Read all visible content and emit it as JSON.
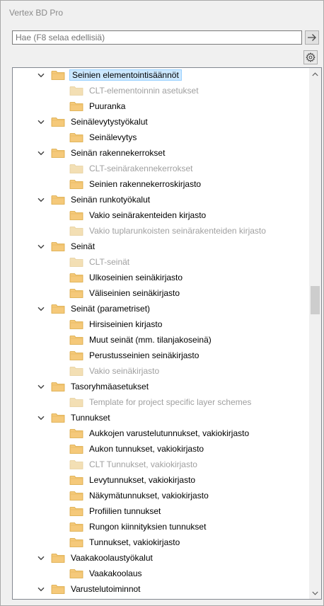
{
  "window": {
    "title": "Vertex BD Pro"
  },
  "search": {
    "placeholder": "Hae (F8 selaa edellisiä)",
    "value": ""
  },
  "icons": {
    "go": "arrow-right-icon",
    "settings": "gear-icon",
    "folder": "folder-icon",
    "expand": "chevron-down-icon"
  },
  "colors": {
    "folder": "#f5c97a",
    "folder_disabled": "#f3dfb4",
    "selection": "#cce8ff",
    "disabled_text": "#a0a0a0"
  },
  "tree": {
    "items": [
      {
        "label": "Seinien elementointisäännöt",
        "level": 0,
        "expanded": true,
        "selected": true,
        "disabled": false
      },
      {
        "label": "CLT-elementoinnin asetukset",
        "level": 1,
        "disabled": true
      },
      {
        "label": "Puuranka",
        "level": 1,
        "disabled": false
      },
      {
        "label": "Seinälevytystyökalut",
        "level": 0,
        "expanded": true,
        "disabled": false
      },
      {
        "label": "Seinälevytys",
        "level": 1,
        "disabled": false
      },
      {
        "label": "Seinän rakennekerrokset",
        "level": 0,
        "expanded": true,
        "disabled": false
      },
      {
        "label": "CLT-seinärakennekerrokset",
        "level": 1,
        "disabled": true
      },
      {
        "label": "Seinien rakennekerroskirjasto",
        "level": 1,
        "disabled": false
      },
      {
        "label": "Seinän runkotyökalut",
        "level": 0,
        "expanded": true,
        "disabled": false
      },
      {
        "label": "Vakio seinärakenteiden kirjasto",
        "level": 1,
        "disabled": false
      },
      {
        "label": "Vakio tuplarunkoisten seinärakenteiden kirjasto",
        "level": 1,
        "disabled": true
      },
      {
        "label": "Seinät",
        "level": 0,
        "expanded": true,
        "disabled": false
      },
      {
        "label": "CLT-seinät",
        "level": 1,
        "disabled": true
      },
      {
        "label": "Ulkoseinien seinäkirjasto",
        "level": 1,
        "disabled": false
      },
      {
        "label": "Väliseinien seinäkirjasto",
        "level": 1,
        "disabled": false
      },
      {
        "label": "Seinät (parametriset)",
        "level": 0,
        "expanded": true,
        "disabled": false
      },
      {
        "label": "Hirsiseinien kirjasto",
        "level": 1,
        "disabled": false
      },
      {
        "label": "Muut seinät (mm. tilanjakoseinä)",
        "level": 1,
        "disabled": false
      },
      {
        "label": "Perustusseinien seinäkirjasto",
        "level": 1,
        "disabled": false
      },
      {
        "label": "Vakio seinäkirjasto",
        "level": 1,
        "disabled": true
      },
      {
        "label": "Tasoryhmäasetukset",
        "level": 0,
        "expanded": true,
        "disabled": false
      },
      {
        "label": "Template for project specific layer schemes",
        "level": 1,
        "disabled": true
      },
      {
        "label": "Tunnukset",
        "level": 0,
        "expanded": true,
        "disabled": false
      },
      {
        "label": "Aukkojen varustelutunnukset, vakiokirjasto",
        "level": 1,
        "disabled": false
      },
      {
        "label": "Aukon tunnukset, vakiokirjasto",
        "level": 1,
        "disabled": false
      },
      {
        "label": "CLT Tunnukset, vakiokirjasto",
        "level": 1,
        "disabled": true
      },
      {
        "label": "Levytunnukset, vakiokirjasto",
        "level": 1,
        "disabled": false
      },
      {
        "label": "Näkymätunnukset, vakiokirjasto",
        "level": 1,
        "disabled": false
      },
      {
        "label": "Profiilien tunnukset",
        "level": 1,
        "disabled": false
      },
      {
        "label": "Rungon kiinnityksien tunnukset",
        "level": 1,
        "disabled": false
      },
      {
        "label": "Tunnukset, vakiokirjasto",
        "level": 1,
        "disabled": false
      },
      {
        "label": "Vaakakoolaustyökalut",
        "level": 0,
        "expanded": true,
        "disabled": false
      },
      {
        "label": "Vaakakoolaus",
        "level": 1,
        "disabled": false
      },
      {
        "label": "Varustelutoiminnot",
        "level": 0,
        "expanded": true,
        "disabled": false
      }
    ]
  }
}
